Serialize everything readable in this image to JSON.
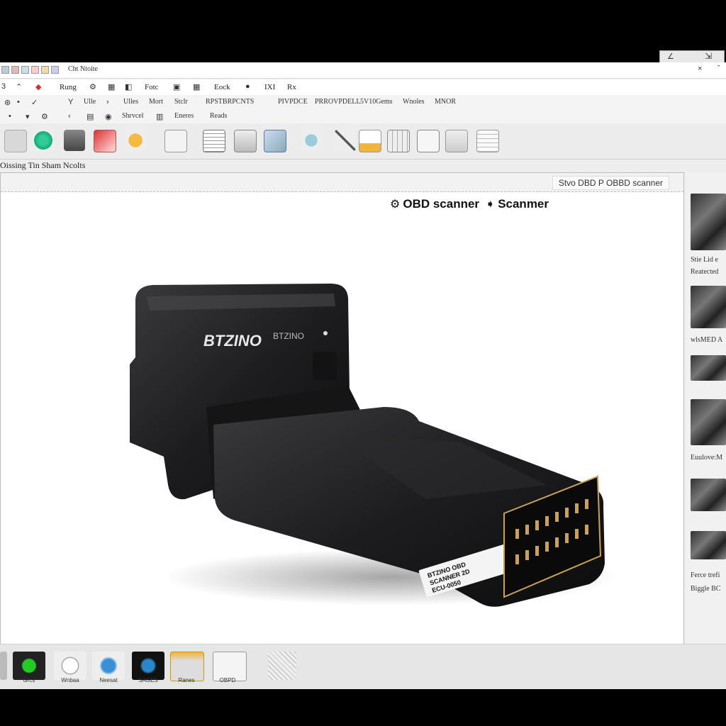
{
  "window": {
    "title": "Cht Ntoite",
    "menu": [
      "Rung",
      "Fotc",
      "Eock",
      "IXI",
      "Rx"
    ],
    "ribbon_row1": [
      "Ulle",
      "Ulles",
      "Mort",
      "Stclr",
      "RPSTBRPCNTS",
      "PIVPDCE",
      "PRROVPDELL",
      "5V10Gems",
      "Wnoles",
      "MNOR"
    ],
    "ribbon_row2": [
      "Shrvcel",
      "Eneres",
      "Reads"
    ],
    "status": "Oissing Tin Sham Ncolts"
  },
  "document": {
    "tab_title": "Stvo DBD P OBBD scanner",
    "heading_left": "OBD scanner",
    "heading_right": "Scanmer",
    "device": {
      "brand": "BTZINO",
      "model": "BTZINO",
      "label_lines": [
        "BTZINO OBD",
        "SCANNER 2D",
        "ECU-0050"
      ]
    }
  },
  "sidebar": {
    "captions": [
      "Stie Lid e",
      "Reatected",
      "wlsMED A",
      "Euulove:M",
      "Ferce trefi",
      "Biggle BC"
    ]
  },
  "taskbar": {
    "apps": [
      "Grcs",
      "Wnbaa",
      "Neesat",
      "SAGES",
      "Ranes",
      "OBPD"
    ]
  },
  "colors": {
    "window_bg": "#eeeeee",
    "device_black": "#1d1d1f",
    "label_white": "#f4f4f4",
    "pin_gold": "#c8a25a"
  }
}
